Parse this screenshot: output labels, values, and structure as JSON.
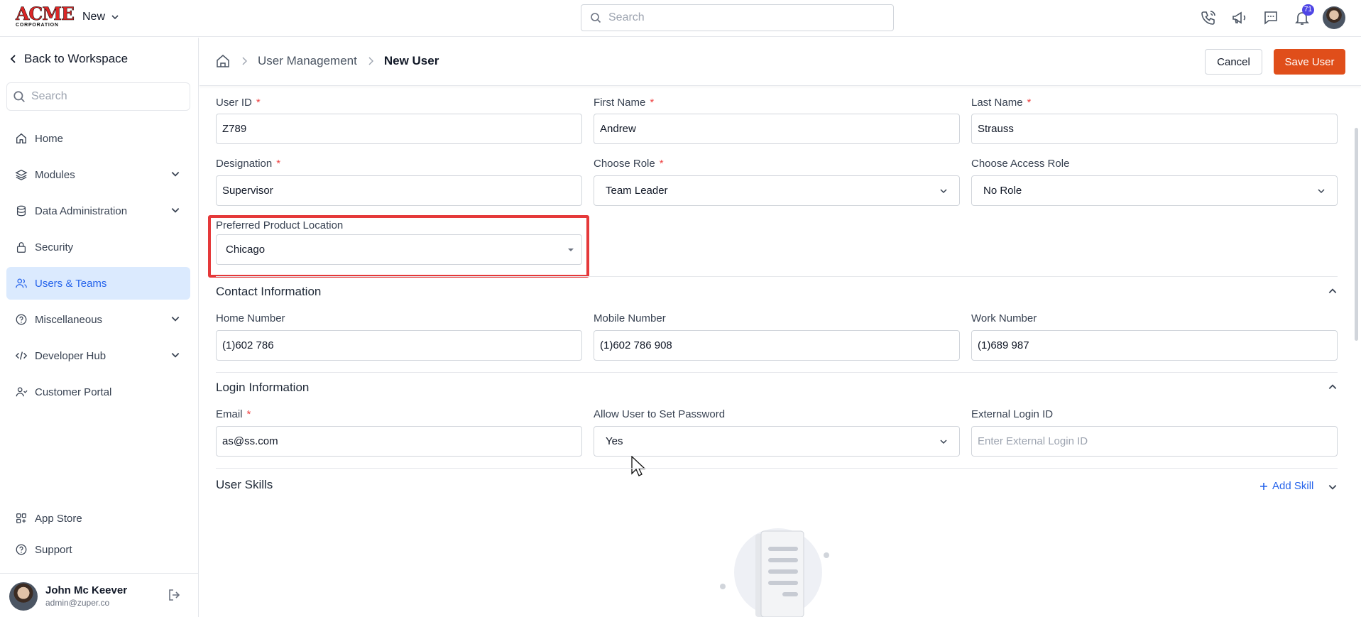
{
  "topbar": {
    "logo_text": "ACME",
    "logo_sub": "CORPORATION",
    "new_label": "New",
    "search_placeholder": "Search",
    "notification_count": "71",
    "icons": [
      "phone-icon",
      "megaphone-icon",
      "chat-icon",
      "bell-icon"
    ]
  },
  "sidebar": {
    "back_label": "Back to Workspace",
    "search_placeholder": "Search",
    "items": [
      {
        "label": "Home",
        "icon": "home-icon"
      },
      {
        "label": "Modules",
        "icon": "layers-icon"
      },
      {
        "label": "Data Administration",
        "icon": "database-icon"
      },
      {
        "label": "Security",
        "icon": "lock-icon"
      },
      {
        "label": "Users & Teams",
        "icon": "users-icon",
        "active": true
      },
      {
        "label": "Miscellaneous",
        "icon": "help-circle-icon"
      },
      {
        "label": "Developer Hub",
        "icon": "code-icon"
      },
      {
        "label": "Customer Portal",
        "icon": "customer-icon"
      }
    ],
    "bottom_items": [
      {
        "label": "App Store",
        "icon": "apps-icon"
      },
      {
        "label": "Support",
        "icon": "support-icon"
      }
    ],
    "user": {
      "name": "John Mc Keever",
      "email": "admin@zuper.co"
    }
  },
  "header": {
    "breadcrumb": [
      "User Management",
      "New User"
    ],
    "cancel_label": "Cancel",
    "save_label": "Save User"
  },
  "form": {
    "user_id": {
      "label": "User ID",
      "value": "Z789"
    },
    "first_name": {
      "label": "First Name",
      "value": "Andrew"
    },
    "last_name": {
      "label": "Last Name",
      "value": "Strauss"
    },
    "designation": {
      "label": "Designation",
      "value": "Supervisor"
    },
    "choose_role": {
      "label": "Choose Role",
      "value": "Team Leader"
    },
    "access_role": {
      "label": "Choose Access Role",
      "value": "No Role"
    },
    "product_location": {
      "label": "Preferred Product Location",
      "value": "Chicago"
    },
    "contact": {
      "title": "Contact Information",
      "home": {
        "label": "Home Number",
        "value": "(1)602 786"
      },
      "mobile": {
        "label": "Mobile Number",
        "value": "(1)602 786 908"
      },
      "work": {
        "label": "Work Number",
        "value": "(1)689 987"
      }
    },
    "login": {
      "title": "Login Information",
      "email": {
        "label": "Email",
        "value": "as@ss.com"
      },
      "allow_password": {
        "label": "Allow User to Set Password",
        "value": "Yes"
      },
      "external_id": {
        "label": "External Login ID",
        "placeholder": "Enter External Login ID"
      }
    },
    "skills": {
      "title": "User Skills",
      "add_label": "Add Skill"
    }
  },
  "colors": {
    "accent": "#e04e1a",
    "active_nav": "#dbeafe",
    "link": "#2563eb",
    "highlight": "#e5393a"
  }
}
